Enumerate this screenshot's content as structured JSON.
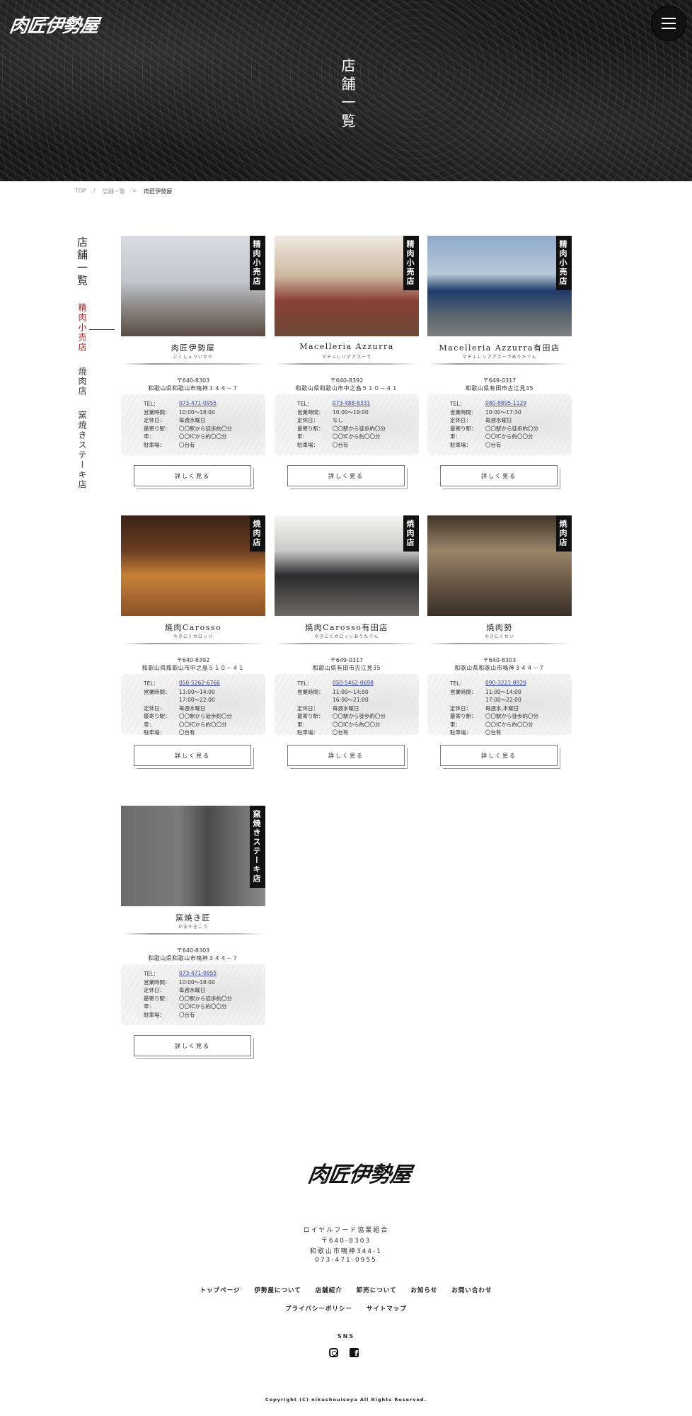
{
  "site": {
    "logo_text": "肉匠伊勢屋",
    "menu_icon": "hamburger-icon"
  },
  "hero": {
    "title": "店舗一覧"
  },
  "breadcrumb": {
    "items": [
      "TOP",
      "店舗一覧",
      "肉匠伊勢屋"
    ]
  },
  "sidenav": {
    "title": "店舗一覧",
    "items": [
      {
        "label": "精肉小売店",
        "active": true
      },
      {
        "label": "焼肉店",
        "active": false
      },
      {
        "label": "窯焼きステーキ店",
        "active": false
      }
    ]
  },
  "labels": {
    "tel": "TEL：",
    "hours": "営業時間：",
    "closed": "定休日：",
    "station": "最寄り駅：",
    "car": "車：",
    "parking": "駐車場：",
    "detail_button": "詳しく見る"
  },
  "stores": [
    {
      "tag": "精肉小売店",
      "name": "肉匠伊勢屋",
      "kana": "にくしょういせや",
      "zip": "〒640-8303",
      "address": "和歌山県和歌山市鳴神３４４－７",
      "tel": "073-471-0955",
      "hours": [
        "10:00～18:00"
      ],
      "closed": "毎週水曜日",
      "station": "〇〇駅から徒歩約〇分",
      "car": "〇〇ICから約〇〇分",
      "parking": "〇台有"
    },
    {
      "tag": "精肉小売店",
      "name": "Macelleria Azzurra",
      "kana": "マチェレリアアズーラ",
      "zip": "〒640-8392",
      "address": "和歌山県和歌山市中之島５１０－４１",
      "tel": "073-488-8331",
      "hours": [
        "10:00～19:00"
      ],
      "closed": "なし",
      "station": "〇〇駅から徒歩約〇分",
      "car": "〇〇ICから約〇〇分",
      "parking": "〇台有"
    },
    {
      "tag": "精肉小売店",
      "name": "Macelleria Azzurra有田店",
      "kana": "マチェレリアアズーラありたでん",
      "zip": "〒649-0317",
      "address": "和歌山県有田市古江見35",
      "tel": "080-8895-1129",
      "hours": [
        "10:00～17:30"
      ],
      "closed": "毎週水曜日",
      "station": "〇〇駅から徒歩約〇分",
      "car": "〇〇ICから約〇〇分",
      "parking": "〇台有"
    },
    {
      "tag": "焼肉店",
      "name": "焼肉Carosso",
      "kana": "やきにくカロッソ",
      "zip": "〒640-8392",
      "address": "和歌山県和歌山市中之島５１０－４１",
      "tel": "050-5262-6766",
      "hours": [
        "11:00～14:00",
        "17:00～22:00"
      ],
      "closed": "毎週水曜日",
      "station": "〇〇駅から徒歩約〇分",
      "car": "〇〇ICから約〇〇分",
      "parking": "〇台有"
    },
    {
      "tag": "焼肉店",
      "name": "焼肉Carosso有田店",
      "kana": "やきにくカロッソありたでん",
      "zip": "〒649-0317",
      "address": "和歌山県有田市古江見35",
      "tel": "050-5462-0698",
      "hours": [
        "11:00～14:00",
        "16:00～21:00"
      ],
      "closed": "毎週水曜日",
      "station": "〇〇駅から徒歩約〇分",
      "car": "〇〇ICから約〇〇分",
      "parking": "〇台有"
    },
    {
      "tag": "焼肉店",
      "name": "焼肉勢",
      "kana": "やきにくせい",
      "zip": "〒640-8303",
      "address": "和歌山県和歌山市鳴神３４４－７",
      "tel": "090-3221-8929",
      "hours": [
        "11:00～14:00",
        "17:00～22:00"
      ],
      "closed": "毎週水,木曜日",
      "station": "〇〇駅から徒歩約〇分",
      "car": "〇〇ICから約〇〇分",
      "parking": "〇台有"
    },
    {
      "tag": "窯焼きステーキ店",
      "name": "窯焼き匠",
      "kana": "かまやきこう",
      "zip": "〒640-8303",
      "address": "和歌山県和歌山市鳴神３４４－７",
      "tel": "073-471-0955",
      "hours": [
        "10:00～18:00"
      ],
      "closed": "毎週水曜日",
      "station": "〇〇駅から徒歩約〇分",
      "car": "〇〇ICから約〇〇分",
      "parking": "〇台有"
    }
  ],
  "footer": {
    "logo_text": "肉匠伊勢屋",
    "company": "ロイヤルフード協業組合",
    "zip": "〒640-8303",
    "address": "和歌山市鳴神344-1",
    "tel": "073-471-0955",
    "nav1": [
      "トップページ",
      "伊勢屋について",
      "店舗紹介",
      "卸売について",
      "お知らせ",
      "お問い合わせ"
    ],
    "nav2": [
      "プライバシーポリシー",
      "サイトマップ"
    ],
    "sns_label": "SNS",
    "copyright": "Copyright (C) nikushouiseya All Rights Reserved."
  }
}
